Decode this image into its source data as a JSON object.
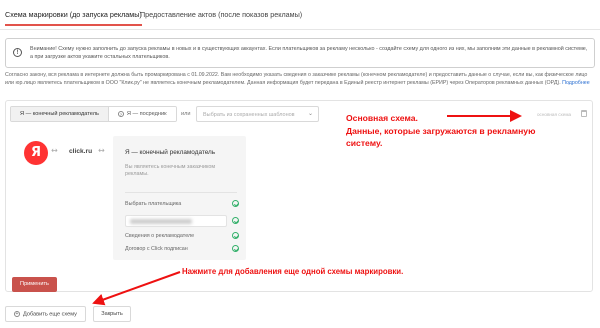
{
  "tabs": [
    {
      "label": "Схема маркировки (до запуска рекламы)",
      "active": true
    },
    {
      "label": "Предоставление актов (после показов рекламы)",
      "active": false
    }
  ],
  "alert": {
    "icon": "exclamation-circle-icon",
    "text": "Внимание! Схему нужно заполнить до запуска рекламы в новых и в существующих аккаунтах. Если плательщиков за рекламу несколько - создайте схему для одного из них, мы заполним эти данные в рекламной системе, а при загрузке актов укажите остальных плательщиков."
  },
  "law": {
    "text": "Согласно закону, вся реклама в интернете должна быть промаркирована с 01.09.2022. Вам необходимо указать сведения о заказчике рекламы (конечном рекламодателе) и предоставить данные о случае, если вы, как физическое лицо или юр.лицо являетесь плательщиком в ООО \"Клик.ру\" не являетесь конечным рекламодателем. Данная информация будет передана в Единый реестр интернет рекламы (ЕРИР) через Операторов рекламных данных (ОРД).",
    "link": "Подробнее"
  },
  "scheme": {
    "options": [
      {
        "label": "Я — конечный рекламодатель",
        "selected": true,
        "icon": ""
      },
      {
        "label": "Я — посредник",
        "selected": false,
        "icon": "question-circle-icon"
      }
    ],
    "or_label": "или",
    "template_placeholder": "Выбрать из сохраненных шаблонов",
    "main_label": "основная схема"
  },
  "diagram": {
    "yandex_logo": "Я",
    "clickru": "click.ru",
    "advertiser_title": "Я — конечный рекламодатель",
    "advertiser_desc": "Вы являетесь конечным заказчиком рекламы.",
    "payer_label": "Выбрать плательщика",
    "advertiser_info_label": "Сведения о рекламодателе",
    "contract_label": "Договор с Click подписан"
  },
  "buttons": {
    "apply": "Применить",
    "add_scheme": "Добавить еще схему",
    "close": "Закрыть"
  },
  "annotations": {
    "main_scheme": [
      "Основная схема.",
      "Данные, которые загружаются в рекламную",
      "систему."
    ],
    "add_hint": "Нажмите для добавления еще одной схемы маркировки."
  },
  "colors": {
    "accent": "#e2534b",
    "apply_button": "#c9524c",
    "annotation": "#ee1111",
    "success": "#33b06a",
    "yandex": "#ff3333"
  }
}
